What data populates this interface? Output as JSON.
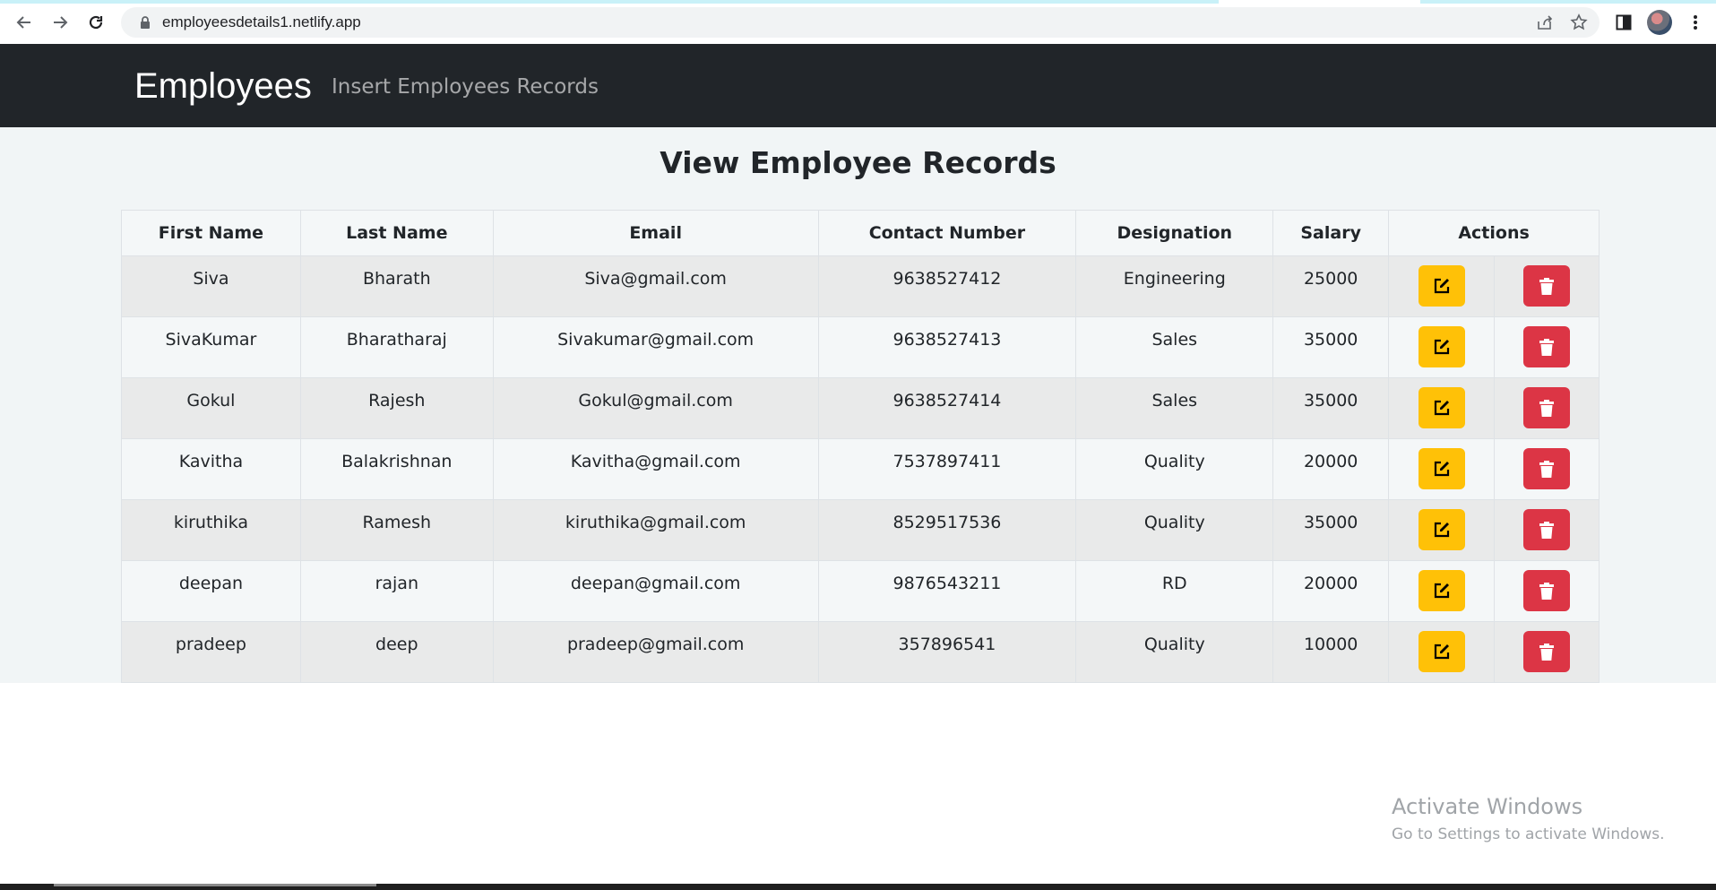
{
  "browser": {
    "url": "employeesdetails1.netlify.app",
    "icons": [
      "back-icon",
      "forward-icon",
      "reload-icon",
      "lock-icon",
      "share-icon",
      "star-icon",
      "side-panel-icon",
      "profile-avatar",
      "menu-icon"
    ]
  },
  "navbar": {
    "brand": "Employees",
    "link": "Insert Employees Records"
  },
  "main": {
    "title": "View Employee Records"
  },
  "table": {
    "headers": [
      "First Name",
      "Last Name",
      "Email",
      "Contact Number",
      "Designation",
      "Salary",
      "Actions"
    ],
    "rows": [
      {
        "first": "Siva",
        "last": "Bharath",
        "email": "Siva@gmail.com",
        "contact": "9638527412",
        "designation": "Engineering",
        "salary": "25000"
      },
      {
        "first": "SivaKumar",
        "last": "Bharatharaj",
        "email": "Sivakumar@gmail.com",
        "contact": "9638527413",
        "designation": "Sales",
        "salary": "35000"
      },
      {
        "first": "Gokul",
        "last": "Rajesh",
        "email": "Gokul@gmail.com",
        "contact": "9638527414",
        "designation": "Sales",
        "salary": "35000"
      },
      {
        "first": "Kavitha",
        "last": "Balakrishnan",
        "email": "Kavitha@gmail.com",
        "contact": "7537897411",
        "designation": "Quality",
        "salary": "20000"
      },
      {
        "first": "kiruthika",
        "last": "Ramesh",
        "email": "kiruthika@gmail.com",
        "contact": "8529517536",
        "designation": "Quality",
        "salary": "35000"
      },
      {
        "first": "deepan",
        "last": "rajan",
        "email": "deepan@gmail.com",
        "contact": "9876543211",
        "designation": "RD",
        "salary": "20000"
      },
      {
        "first": "pradeep",
        "last": "deep",
        "email": "pradeep@gmail.com",
        "contact": "357896541",
        "designation": "Quality",
        "salary": "10000"
      }
    ]
  },
  "colors": {
    "navbar": "#212529",
    "edit_button": "#ffc107",
    "delete_button": "#dc3545",
    "page_background": "#f1f5f6"
  },
  "watermark": {
    "line1": "Activate Windows",
    "line2": "Go to Settings to activate Windows."
  }
}
